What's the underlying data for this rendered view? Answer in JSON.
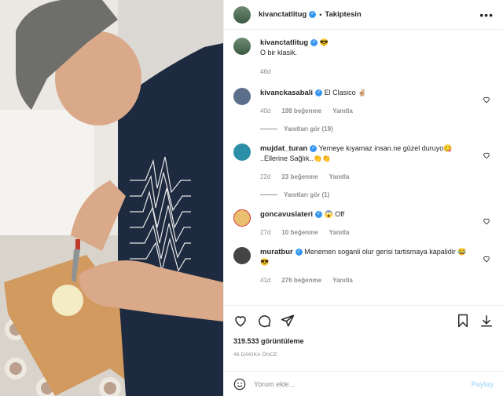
{
  "post": {
    "author": "kivanctatlitug",
    "follow_status": "Takiptesin",
    "more": "•••",
    "caption": "O bir klasik.",
    "caption_emoji": "😎",
    "caption_time": "46d"
  },
  "comments": [
    {
      "user": "kivanckasabali",
      "verified": true,
      "text": "El Clasico ✌🏼",
      "time": "40d",
      "likes": "198 beğenme",
      "reply": "Yanıtla",
      "view_replies": "Yanıtları gör (19)",
      "avatar_color": "#5b6f8a"
    },
    {
      "user": "mujdat_turan",
      "verified": true,
      "text": "Yemeye kıyamaz insan.ne güzel duruyo😋 ..Ellerine Sağlık..👏👏",
      "time": "22d",
      "likes": "23 beğenme",
      "reply": "Yanıtla",
      "view_replies": "Yanıtları gör (1)",
      "avatar_color": "#2c8fa8"
    },
    {
      "user": "goncavuslateri",
      "verified": true,
      "text": "😱 Off",
      "time": "27d",
      "likes": "10 beğenme",
      "reply": "Yanıtla",
      "view_replies": "",
      "avatar_color": "#e8c070"
    },
    {
      "user": "muratbur",
      "verified": true,
      "text": "Menemen soganli olur gerisi tartismaya kapalidir 😂😎",
      "time": "41d",
      "likes": "276 beğenme",
      "reply": "Yanıtla",
      "view_replies": "",
      "avatar_color": "#444444"
    }
  ],
  "stats": {
    "views": "319.533 görüntüleme",
    "posted": "46 DAKİKA ÖNCE"
  },
  "comment_box": {
    "placeholder": "Yorum ekle...",
    "post_label": "Paylaş"
  },
  "icons": [
    "heart-icon",
    "comment-icon",
    "share-icon",
    "bookmark-icon",
    "download-icon",
    "emoji-icon",
    "verified-icon"
  ],
  "colors": {
    "verified": "#3897f0",
    "muted": "#8e8e8e",
    "post_disabled": "#b2dffc"
  }
}
